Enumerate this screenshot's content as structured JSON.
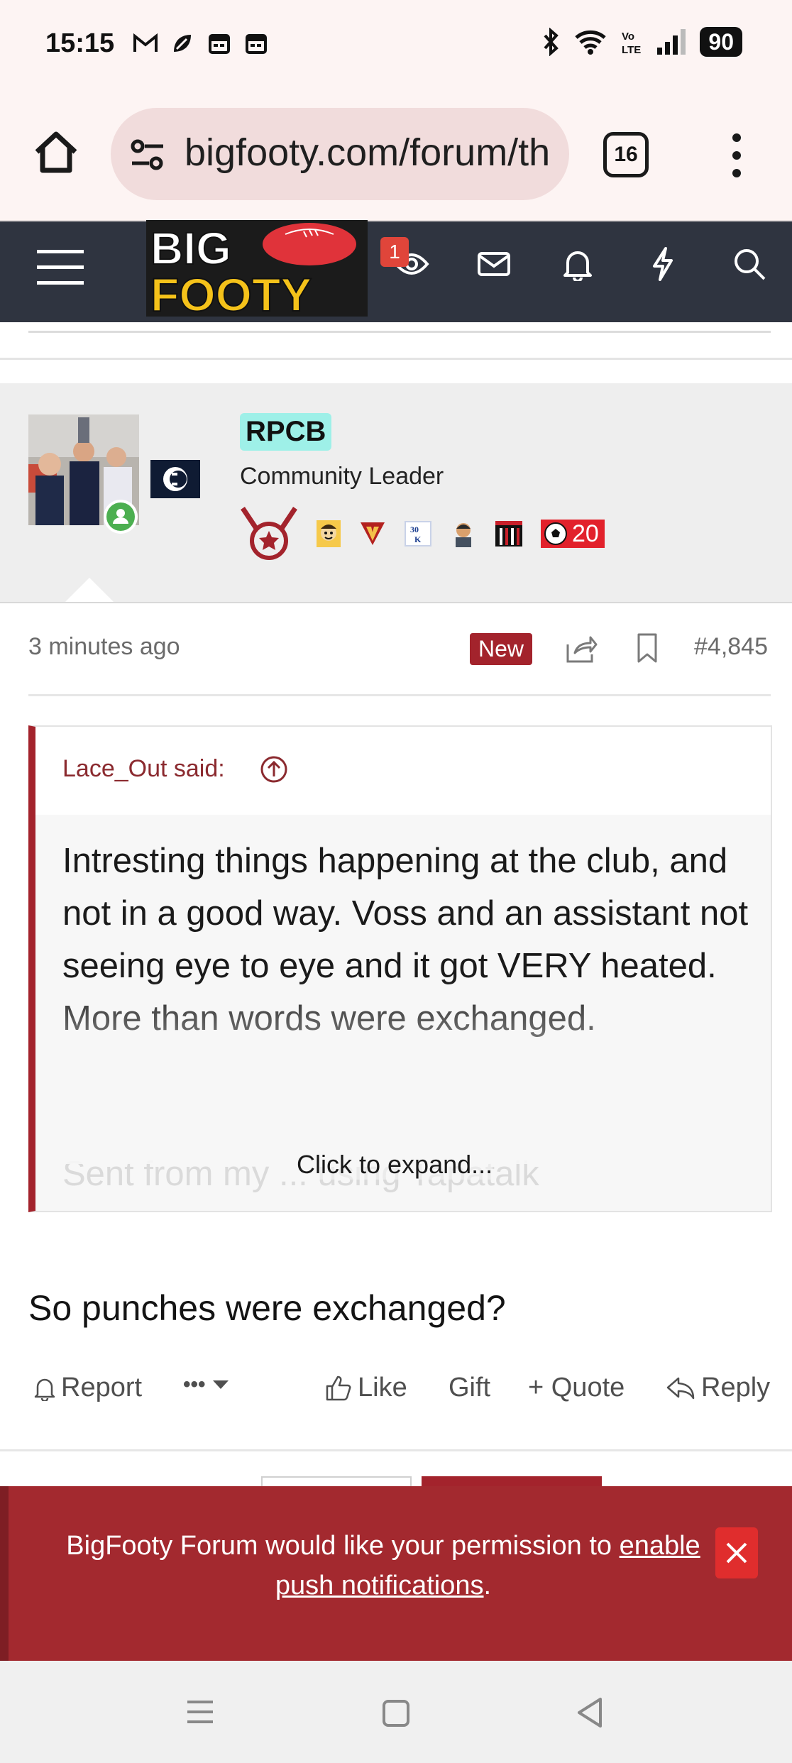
{
  "status_bar": {
    "time": "15:15",
    "left_icons": [
      "gmail-icon",
      "leaf-icon",
      "calendar-icon",
      "calendar-icon"
    ],
    "right_icons": [
      "bluetooth-icon",
      "wifi-icon",
      "volte-icon",
      "signal-icon"
    ],
    "battery": "90"
  },
  "browser": {
    "url": "bigfooty.com/forum/th",
    "tab_count": "16"
  },
  "site_header": {
    "logo_line1": "BIG",
    "logo_line2": "FOOTY",
    "watched_badge": "1",
    "nav_icons": [
      "eye-icon",
      "mail-icon",
      "bell-icon",
      "lightning-icon",
      "search-icon"
    ]
  },
  "user": {
    "username": "RPCB",
    "title": "Community Leader",
    "trophy_count": "20"
  },
  "post": {
    "time": "3 minutes ago",
    "new_label": "New",
    "number": "#4,845",
    "quote": {
      "author": "Lace_Out said:",
      "text": "Intresting things happening at the club, and not in a good way. Voss and an assistant not seeing eye to eye and it got VERY heated. More than words were exchanged.",
      "hidden_text": "Sent from my ... using Tapatalk",
      "expand": "Click to expand..."
    },
    "body": "So punches were exchanged?"
  },
  "actions": {
    "report": "Report",
    "more": "•••",
    "like": "Like",
    "gift": "Gift",
    "quote": "+ Quote",
    "reply": "Reply"
  },
  "push_banner": {
    "text_before": "BigFooty Forum would like your permission to ",
    "link": "enable push notifications",
    "text_after": "."
  },
  "colors": {
    "brand_red": "#a3232c",
    "header_dark": "#2f3440",
    "username_highlight": "#9ef0e8"
  }
}
